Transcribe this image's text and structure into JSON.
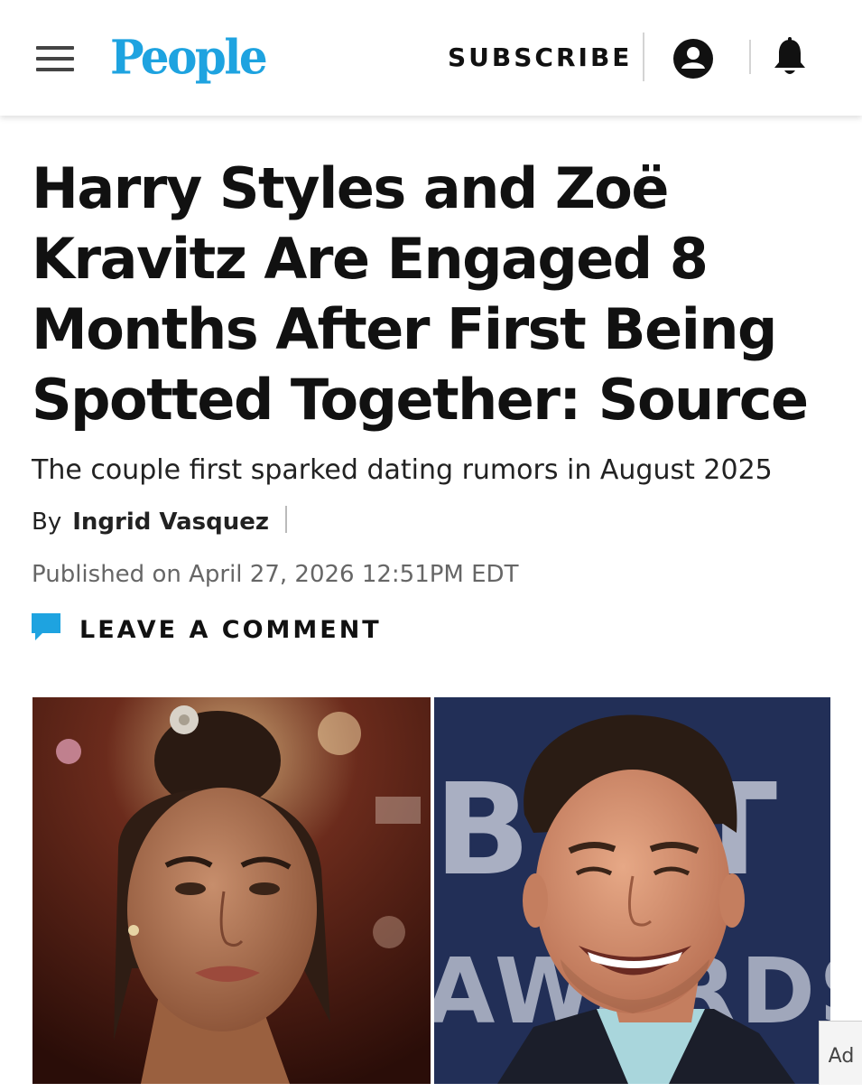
{
  "header": {
    "logo": "People",
    "subscribe_label": "SUBSCRIBE",
    "colors": {
      "brand": "#1ea3e0"
    },
    "icons": [
      "hamburger-menu-icon",
      "account-icon",
      "bell-icon"
    ]
  },
  "article": {
    "headline": "Harry Styles and Zoë Kravitz Are Engaged 8 Months After First Being Spotted Together: Source",
    "subheadline": "The couple first sparked dating rumors in August 2025",
    "byline_prefix": "By",
    "author": "Ingrid Vasquez",
    "published": "Published on April 27, 2026 12:51PM EDT",
    "comment_label": "LEAVE A COMMENT",
    "comment_icon_color": "#1ea3e0"
  },
  "photo_right_backdrop_text": "BRIT AWARDS",
  "ad_label": "Ad"
}
